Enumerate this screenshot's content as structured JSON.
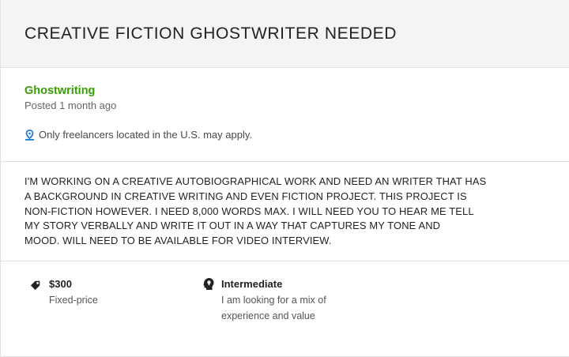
{
  "job": {
    "title": "CREATIVE FICTION GHOSTWRITER NEEDED",
    "category": "Ghostwriting",
    "posted": "Posted 1 month ago",
    "location_notice": "Only freelancers located in the U.S. may apply.",
    "description": "I'M WORKING ON A CREATIVE AUTOBIOGRAPHICAL WORK AND NEED AN WRITER THAT HAS\nA BACKGROUND IN CREATIVE WRITING AND EVEN FICTION PROJECT.  THIS PROJECT IS\nNON-FICTION HOWEVER.  I NEED 8,000 WORDS MAX.  I WILL NEED YOU TO HEAR ME TELL\nMY STORY VERBALLY AND WRITE IT OUT IN A WAY THAT CAPTURES MY TONE AND\nMOOD.  WILL NEED TO BE AVAILABLE FOR VIDEO INTERVIEW."
  },
  "details": {
    "price": {
      "amount": "$300",
      "type": "Fixed-price",
      "icon": "price-tag-icon"
    },
    "level": {
      "label": "Intermediate",
      "description": "I am looking for a mix of\nexperience and value",
      "icon": "head-lightbulb-icon"
    }
  },
  "colors": {
    "category": "#37a000",
    "location_pin": "#1d7bd0",
    "header_bg": "#f4f4f4",
    "divider": "#e0e0e0"
  }
}
